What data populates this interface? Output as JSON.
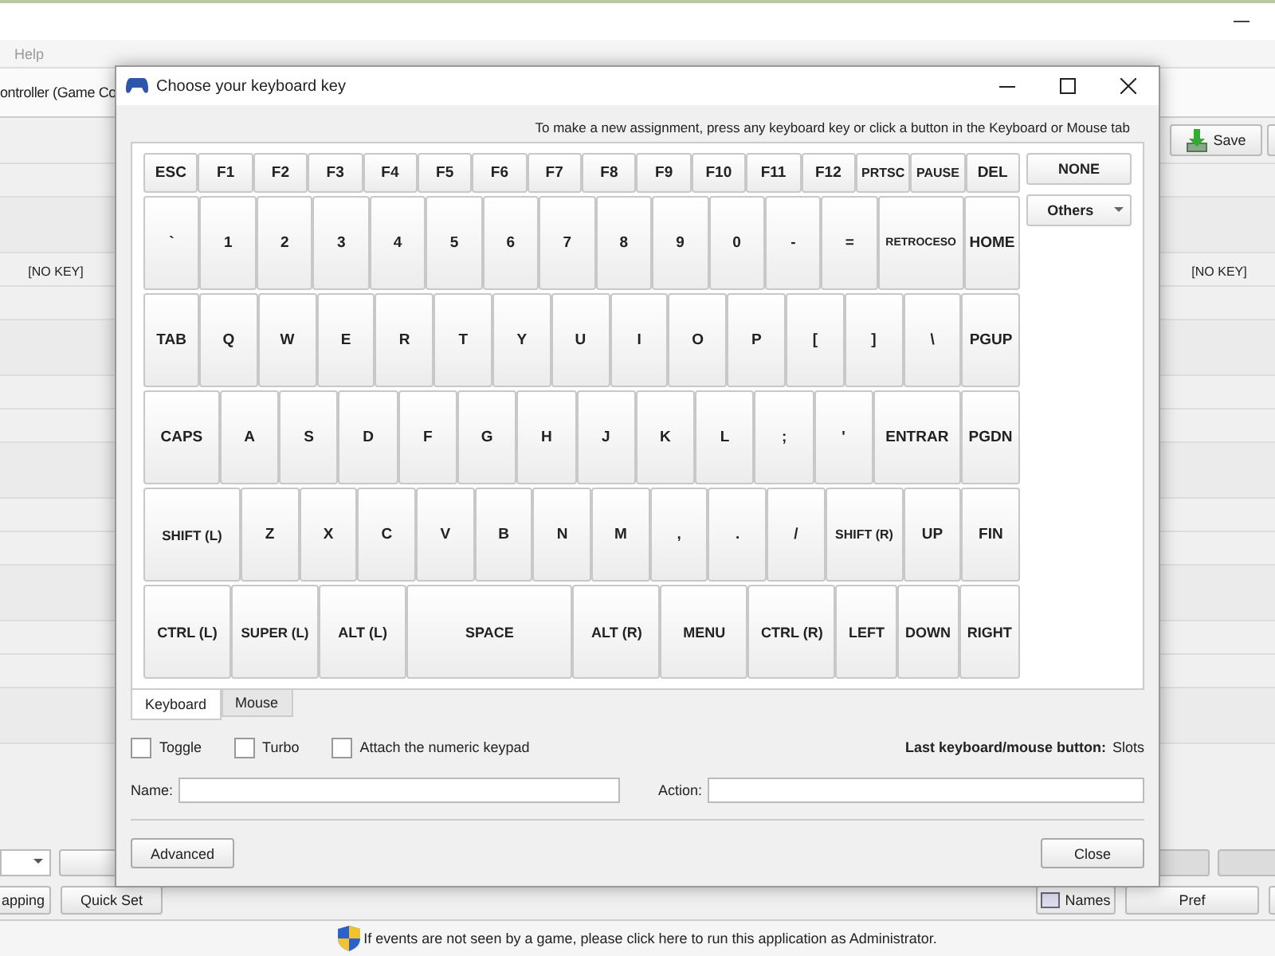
{
  "main_window": {
    "menu": [
      "Help"
    ],
    "controller": "ontroller (Game Co",
    "save_button": "Save",
    "key_left": "[NO KEY]",
    "key_right": "[NO KEY]",
    "left_buttons": [
      "apping",
      "Quick Set"
    ],
    "right_buttons": [
      "Names",
      "Pref"
    ],
    "status_text": "If events are not seen by a game, please click here to run this application as Administrator."
  },
  "dialog": {
    "title": "Choose your keyboard key",
    "instruction": "To make a new assignment, press any keyboard key or click a button in the Keyboard or Mouse tab",
    "rows": [
      {
        "keys": [
          "ESC",
          "F1",
          "F2",
          "F3",
          "F4",
          "F5",
          "F6",
          "F7",
          "F8",
          "F9",
          "F10",
          "F11",
          "F12",
          "PRTSC",
          "PAUSE",
          "DEL"
        ]
      },
      {
        "keys": [
          "`",
          "1",
          "2",
          "3",
          "4",
          "5",
          "6",
          "7",
          "8",
          "9",
          "0",
          "-",
          "=",
          "RETROCESO",
          "HOME"
        ]
      },
      {
        "keys": [
          "TAB",
          "Q",
          "W",
          "E",
          "R",
          "T",
          "Y",
          "U",
          "I",
          "O",
          "P",
          "[",
          "]",
          "\\",
          "PGUP"
        ]
      },
      {
        "keys": [
          "CAPS",
          "A",
          "S",
          "D",
          "F",
          "G",
          "H",
          "J",
          "K",
          "L",
          ";",
          "'",
          "ENTRAR",
          "PGDN"
        ]
      },
      {
        "keys": [
          "SHIFT (L)",
          "Z",
          "X",
          "C",
          "V",
          "B",
          "N",
          "M",
          ",",
          ".",
          "/",
          "SHIFT (R)",
          "UP",
          "FIN"
        ]
      },
      {
        "keys": [
          "CTRL (L)",
          "SUPER (L)",
          "ALT (L)",
          "SPACE",
          "ALT (R)",
          "MENU",
          "CTRL (R)",
          "LEFT",
          "DOWN",
          "RIGHT"
        ]
      }
    ],
    "side_buttons": [
      {
        "label": "NONE",
        "kind": "button"
      },
      {
        "label": "Others",
        "kind": "dropdown"
      }
    ],
    "tabs": [
      {
        "label": "Keyboard",
        "selected": true
      },
      {
        "label": "Mouse",
        "selected": false
      }
    ],
    "options": [
      {
        "label": "Toggle",
        "checked": false
      },
      {
        "label": "Turbo",
        "checked": false
      },
      {
        "label": "Attach the numeric keypad",
        "checked": false
      }
    ],
    "last_label": "Last keyboard/mouse button:",
    "last_value": "Slots",
    "fields": [
      {
        "label": "Name:"
      },
      {
        "label": "Action:"
      }
    ],
    "buttons": [
      "Advanced",
      "Close"
    ]
  }
}
